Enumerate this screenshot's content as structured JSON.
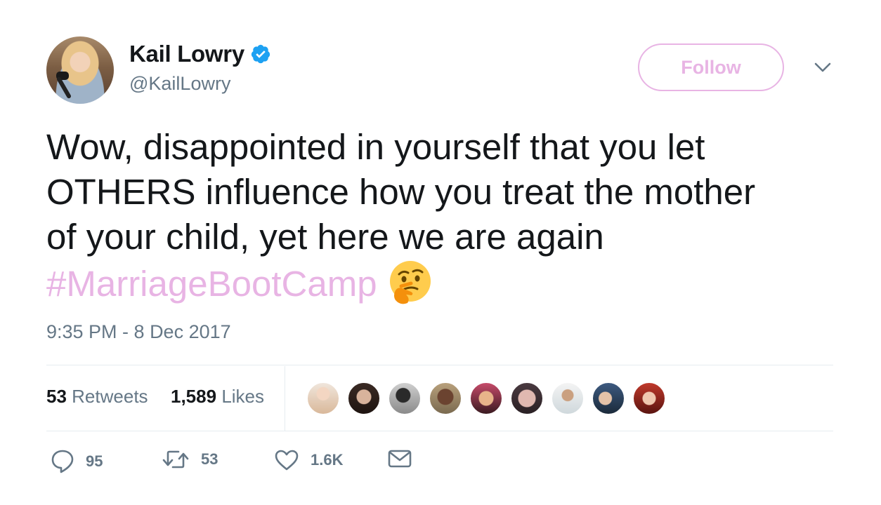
{
  "author": {
    "name": "Kail Lowry",
    "handle": "@KailLowry",
    "verified": true
  },
  "follow_label": "Follow",
  "tweet": {
    "text_lines": [
      "Wow, disappointed in yourself that you let",
      "OTHERS influence how you treat the mother",
      "of your child, yet here we are again"
    ],
    "hashtag": "#MarriageBootCamp",
    "emoji": "thinking-face"
  },
  "timestamp": "9:35 PM - 8 Dec 2017",
  "stats": {
    "retweets_count": "53",
    "retweets_label": "Retweets",
    "likes_count": "1,589",
    "likes_label": "Likes"
  },
  "actions": {
    "replies": "95",
    "retweets": "53",
    "likes": "1.6K"
  },
  "colors": {
    "accent_pink": "#e8b4e4",
    "verified_blue": "#1da1f2",
    "secondary_text": "#657786",
    "primary_text": "#14171a",
    "divider": "#e6ecf0"
  }
}
